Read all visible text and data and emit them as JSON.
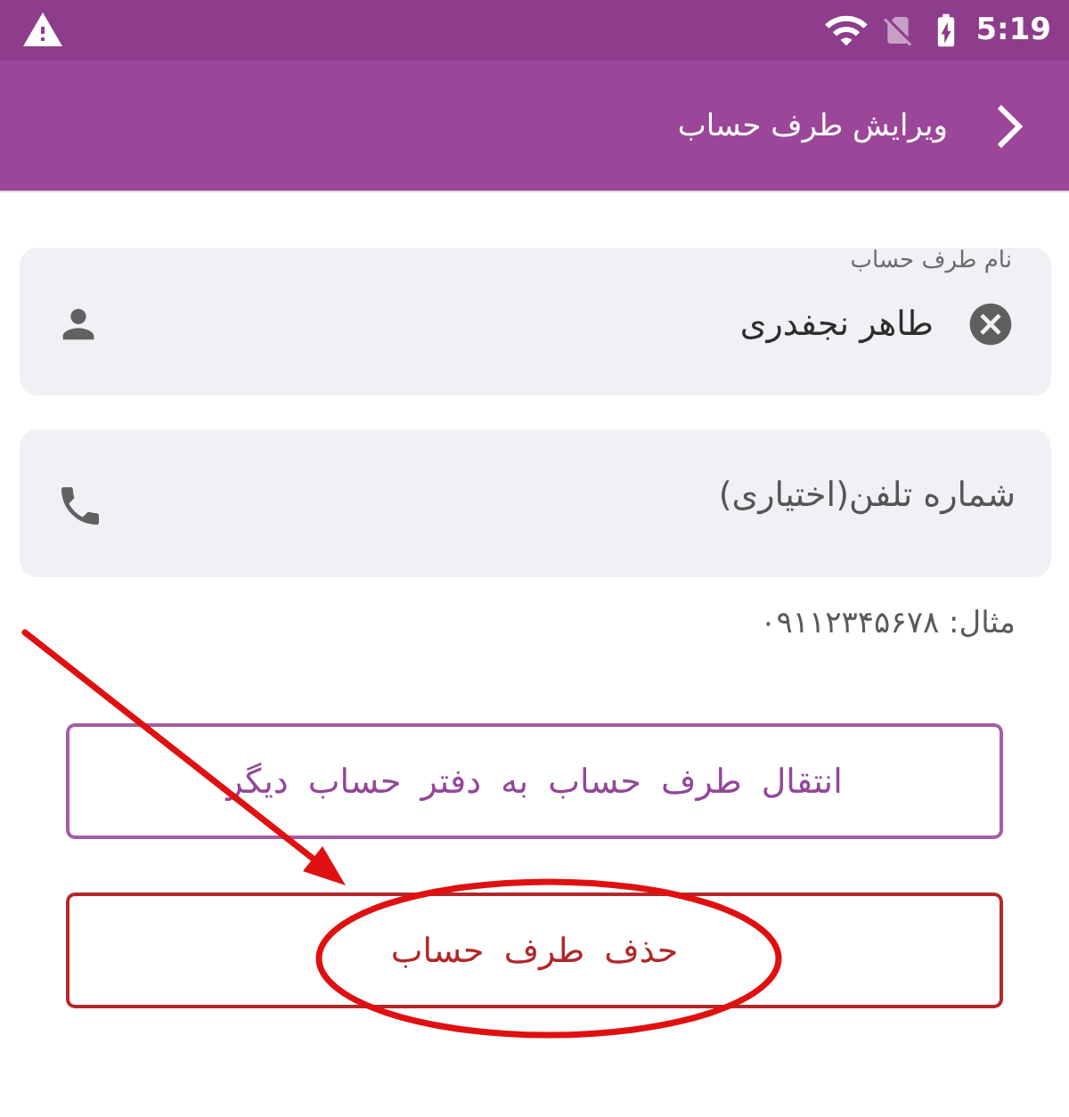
{
  "status_bar": {
    "time": "5:19"
  },
  "app_bar": {
    "title": "ویرایش طرف حساب"
  },
  "fields": [
    {
      "kind": "name",
      "label": "نام طرف حساب",
      "value": "طاهر نجفدری",
      "clearable": true
    },
    {
      "kind": "phone",
      "placeholder": "شماره تلفن(اختیاری)",
      "helper": "مثال: ۰۹۱۱۲۳۴۵۶۷۸",
      "clearable": false
    }
  ],
  "buttons": [
    {
      "kind": "primary",
      "label": "انتقال طرف حساب به دفتر حساب دیگر"
    },
    {
      "kind": "danger",
      "label": "حذف طرف حساب"
    }
  ]
}
